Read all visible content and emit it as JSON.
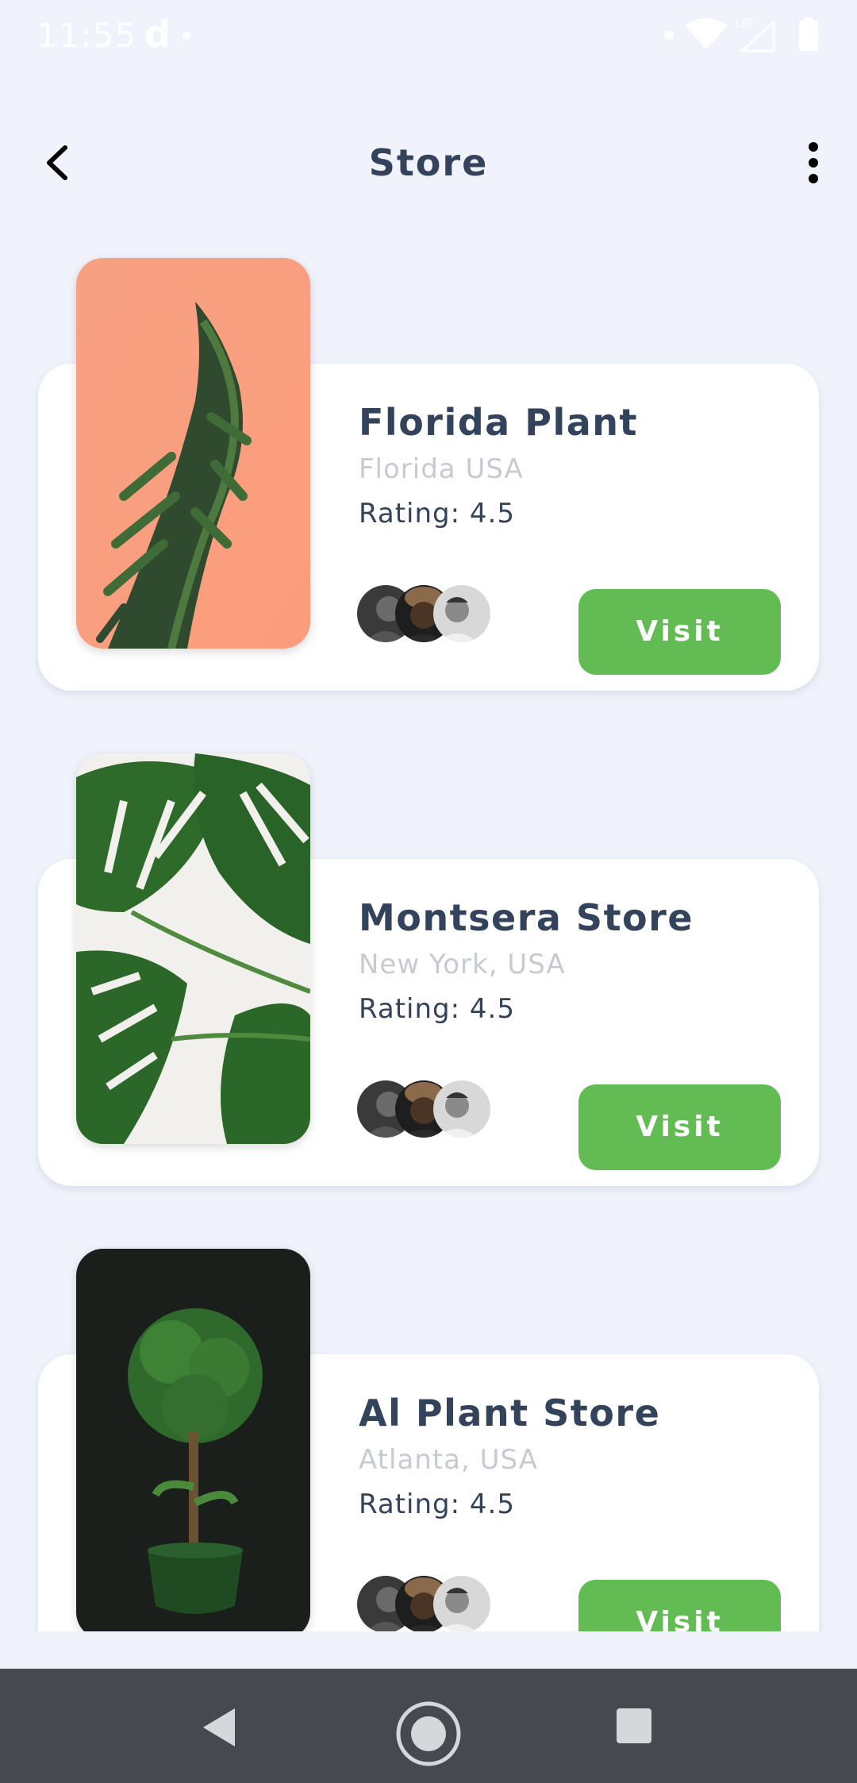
{
  "status_bar": {
    "time": "11:55",
    "app_indicator": "d"
  },
  "header": {
    "title": "Store",
    "back_icon": "chevron-left-icon",
    "menu_icon": "more-vertical-icon"
  },
  "stores": [
    {
      "name": "Florida Plant",
      "location": "Florida USA",
      "rating": "Rating: 4.5",
      "visit_label": "Visit",
      "image": "pine-branch-on-peach"
    },
    {
      "name": "Montsera Store",
      "location": "New York, USA",
      "rating": "Rating: 4.5",
      "visit_label": "Visit",
      "image": "monstera-leaves-on-white"
    },
    {
      "name": "Al Plant Store",
      "location": "Atlanta, USA",
      "rating": "Rating: 4.5",
      "visit_label": "Visit",
      "image": "topiary-in-green-pot-on-dark"
    }
  ],
  "colors": {
    "background": "#f0f3fc",
    "card": "#ffffff",
    "accent_green": "#63bb54",
    "title_text": "#34435c",
    "muted_text": "#c5cad3",
    "nav_bar": "#464a50"
  }
}
